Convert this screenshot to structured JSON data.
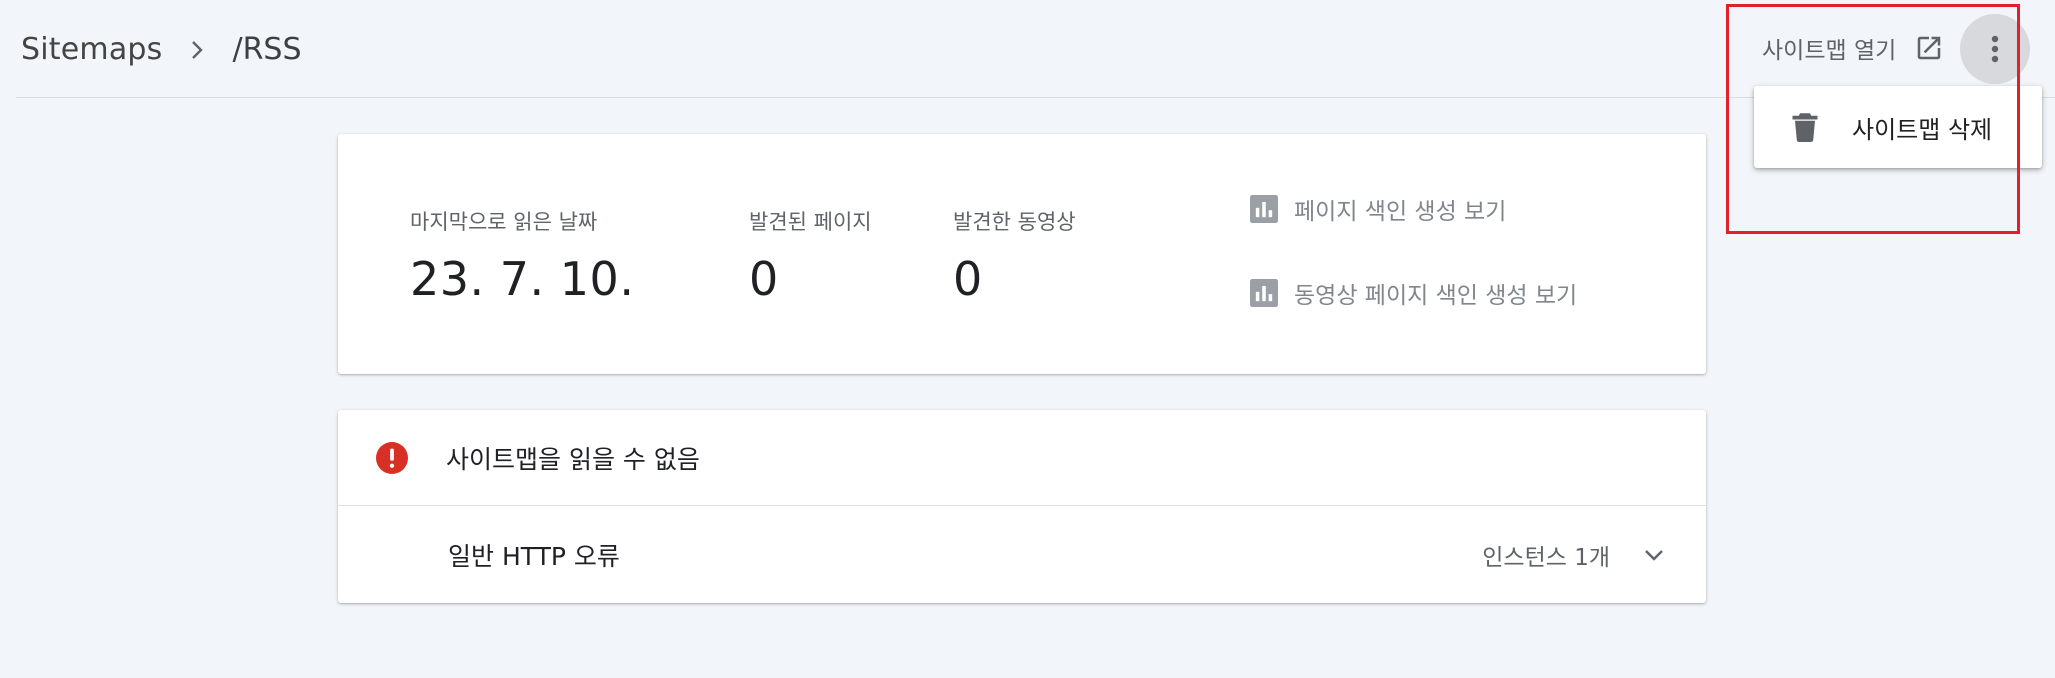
{
  "breadcrumb": {
    "root": "Sitemaps",
    "current": "/RSS"
  },
  "header": {
    "open_sitemap_label": "사이트맵 열기",
    "open_icon": "open-in-new-icon",
    "more_icon": "more-vert-icon"
  },
  "menu": {
    "delete_label": "사이트맵 삭제",
    "delete_icon": "trash-icon"
  },
  "stats": [
    {
      "label": "마지막으로 읽은 날짜",
      "value": "23. 7. 10."
    },
    {
      "label": "발견된 페이지",
      "value": "0"
    },
    {
      "label": "발견한 동영상",
      "value": "0"
    }
  ],
  "reports": [
    {
      "label": "페이지 색인 생성 보기",
      "icon": "bar-chart-icon"
    },
    {
      "label": "동영상 페이지 색인 생성 보기",
      "icon": "bar-chart-icon"
    }
  ],
  "error": {
    "title": "사이트맵을 읽을 수 없음",
    "icon": "error-icon",
    "color": "#d93025"
  },
  "issue": {
    "title": "일반 HTTP 오류",
    "count": "인스턴스 1개",
    "icon": "chevron-down-icon"
  },
  "colors": {
    "highlight": "#e0202a",
    "background": "#f2f5f9"
  }
}
